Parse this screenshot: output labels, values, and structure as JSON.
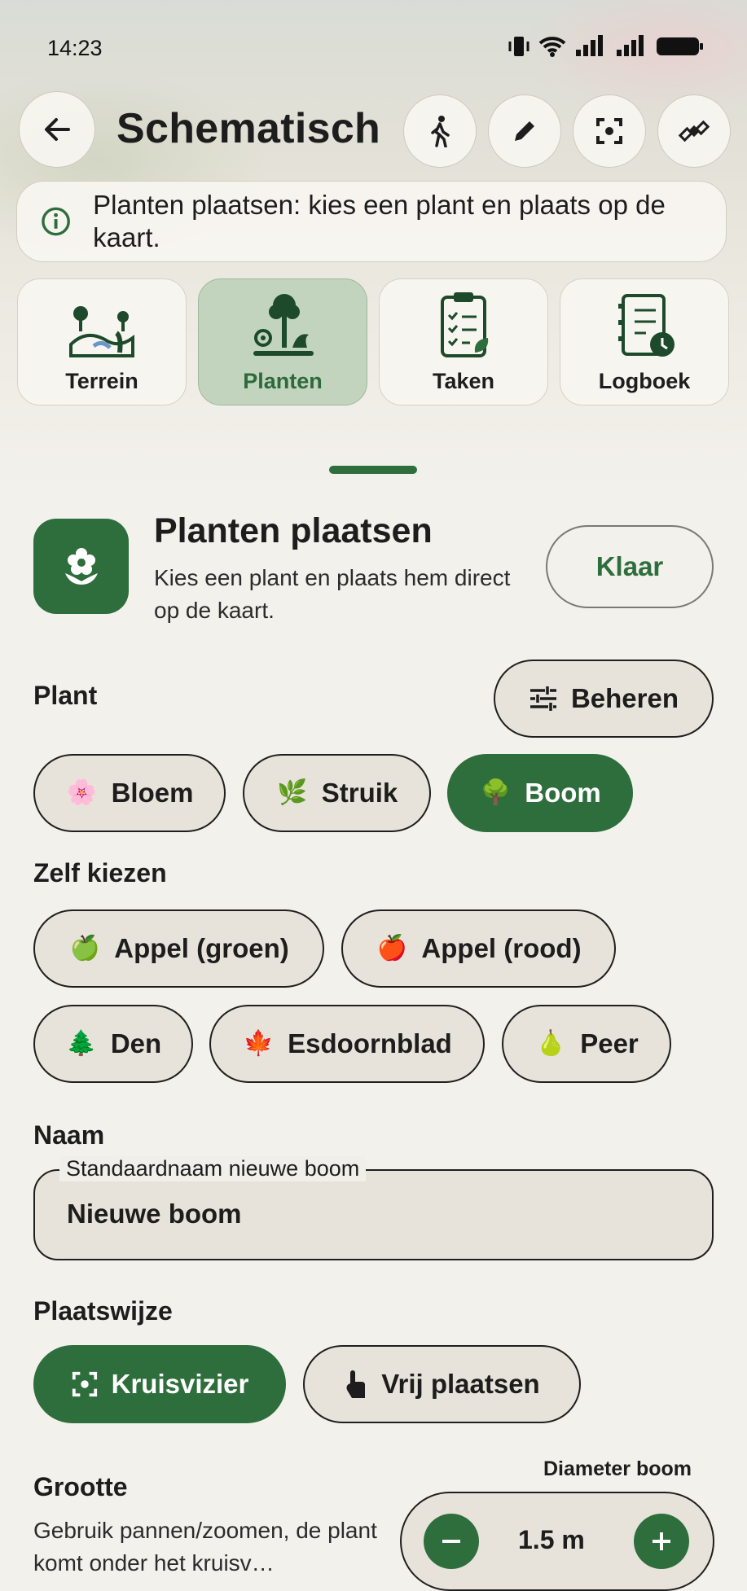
{
  "status_bar": {
    "time": "14:23"
  },
  "header": {
    "title": "Schematisch"
  },
  "info_banner": {
    "text": "Planten plaatsen: kies een plant en plaats op de kaart."
  },
  "tabs": [
    {
      "label": "Terrein",
      "icon": "terrain-icon"
    },
    {
      "label": "Planten",
      "icon": "plants-icon",
      "active": true
    },
    {
      "label": "Taken",
      "icon": "tasks-clipboard-icon"
    },
    {
      "label": "Logboek",
      "icon": "logbook-icon"
    }
  ],
  "panel": {
    "title": "Planten plaatsen",
    "subtitle": "Kies een plant en plaats hem direct op de kaart.",
    "done_label": "Klaar"
  },
  "plant_section": {
    "label": "Plant",
    "manage_label": "Beheren",
    "types": [
      {
        "emoji": "🌸",
        "label": "Bloem"
      },
      {
        "emoji": "🌿",
        "label": "Struik"
      },
      {
        "emoji": "🌳",
        "label": "Boom",
        "selected": true
      }
    ]
  },
  "custom_section": {
    "label": "Zelf kiezen",
    "items": [
      {
        "emoji": "🍏",
        "label": "Appel (groen)"
      },
      {
        "emoji": "🍎",
        "label": "Appel (rood)"
      },
      {
        "emoji": "🌲",
        "label": "Den"
      },
      {
        "emoji": "🍁",
        "label": "Esdoornblad"
      },
      {
        "emoji": "🍐",
        "label": "Peer"
      }
    ]
  },
  "name_section": {
    "label": "Naam",
    "field_label": "Standaardnaam nieuwe boom",
    "field_value": "Nieuwe boom"
  },
  "placement_section": {
    "label": "Plaatswijze",
    "options": [
      {
        "label": "Kruisvizier",
        "selected": true
      },
      {
        "label": "Vrij plaatsen"
      }
    ]
  },
  "size_section": {
    "label": "Grootte",
    "description": "Gebruik pannen/zoomen, de plant komt onder het kruisv…",
    "stepper_label": "Diameter boom",
    "value": "1.5 m"
  },
  "colors": {
    "accent": "#2e6e3c",
    "active_tab": "#c2d4bd",
    "pill_bg": "#e8e3da"
  }
}
